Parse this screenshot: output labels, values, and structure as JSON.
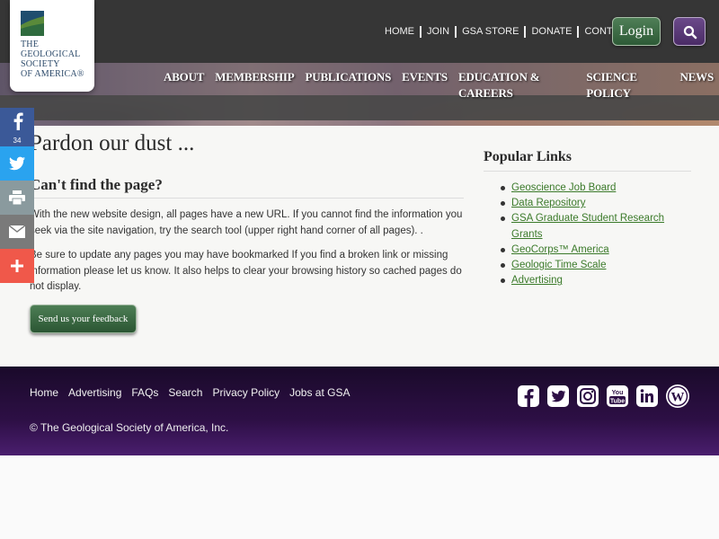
{
  "header": {
    "logo_lines": [
      "THE",
      "GEOLOGICAL",
      "SOCIETY",
      "OF AMERICA®"
    ],
    "utility_nav": [
      "HOME",
      "JOIN",
      "GSA STORE",
      "DONATE",
      "CONTACT"
    ],
    "login_label": "Login",
    "search_icon": "search-icon",
    "main_nav": [
      "ABOUT",
      "MEMBERSHIP",
      "PUBLICATIONS",
      "EVENTS",
      "EDUCATION & CAREERS",
      "SCIENCE POLICY",
      "NEWS"
    ]
  },
  "share": {
    "facebook_count": "34",
    "icons": [
      "facebook-icon",
      "twitter-icon",
      "print-icon",
      "email-icon",
      "plus-icon"
    ],
    "colors": {
      "facebook": "#3b5998",
      "twitter": "#2aa3ef",
      "print": "#8a9a9e",
      "email": "#7a7a7a",
      "more": "#f0584a"
    }
  },
  "main": {
    "title": "Pardon our dust ...",
    "subtitle": "Can't find the page?",
    "paragraph1": "With the new website design, all pages have a new URL. If you cannot find the information you seek via the site navigation, try the search tool (upper right hand corner of all pages). .",
    "paragraph2": "Be sure to update any pages you may have bookmarked If you find a broken link or missing information please let us know. It also helps to clear your browsing history so cached pages do not display.",
    "feedback_label": "Send us your feedback"
  },
  "sidebar": {
    "title": "Popular Links",
    "links": [
      "Geoscience Job Board",
      "Data Repository",
      "GSA Graduate Student Research Grants",
      "GeoCorps™ America",
      "Geologic Time Scale",
      "Advertising"
    ]
  },
  "footer": {
    "nav": [
      "Home",
      "Advertising",
      "FAQs",
      "Search",
      "Privacy Policy",
      "Jobs at GSA"
    ],
    "copyright": "© The Geological Society of America, Inc.",
    "social_icons": [
      "facebook-icon",
      "twitter-icon",
      "instagram-icon",
      "youtube-icon",
      "linkedin-icon",
      "wordpress-icon"
    ]
  },
  "colors": {
    "brand_green": "#3b7a2a",
    "button_green": "#2d5a36",
    "search_purple": "#4a2b66",
    "footer_purple": "#2d0f45"
  }
}
